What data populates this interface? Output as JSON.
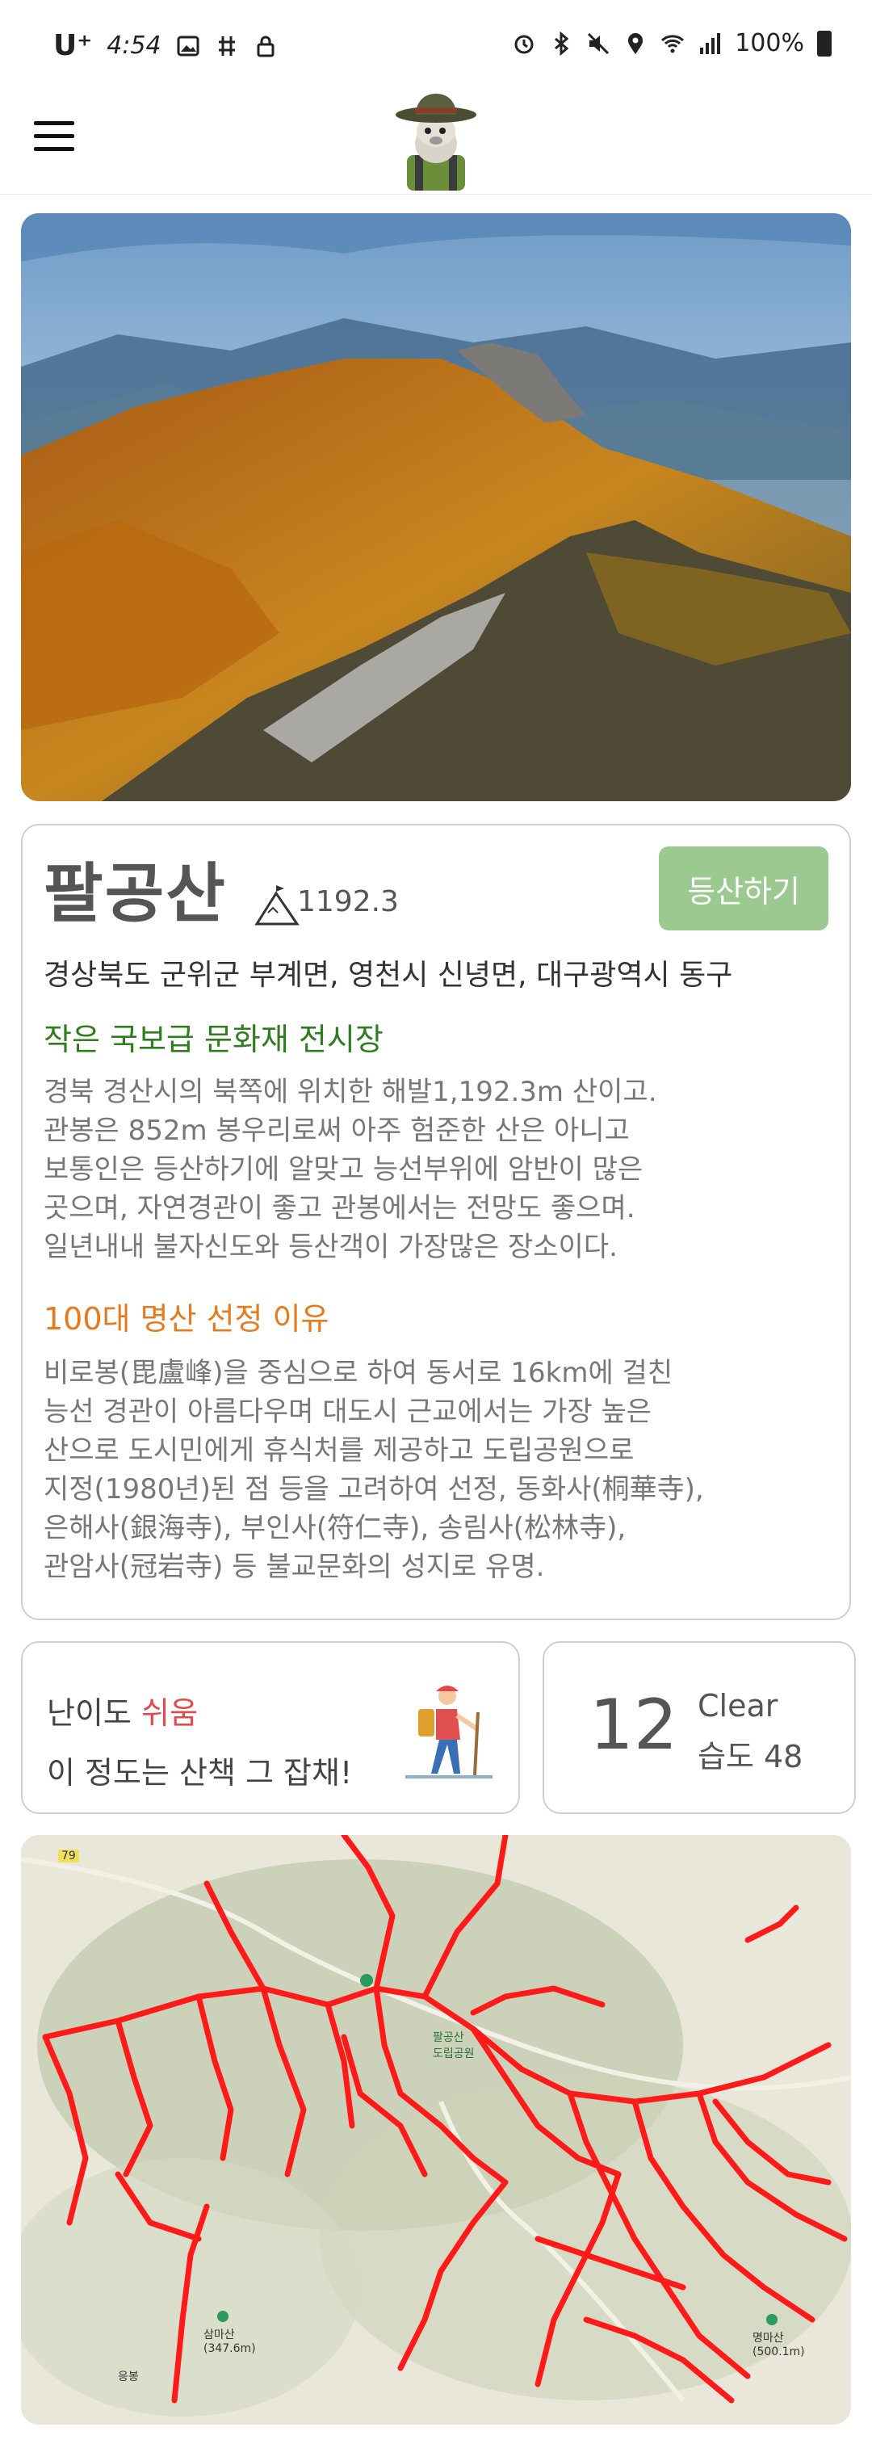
{
  "status_bar": {
    "carrier": "U⁺",
    "time": "4:54",
    "battery": "100%"
  },
  "header": {
    "menu_icon": "hamburger-menu-icon",
    "logo_icon": "mascot-hiker-logo"
  },
  "mountain": {
    "name": "팔공산",
    "height": "1192.3",
    "climb_button": "등산하기",
    "address": "경상북도 군위군 부계면, 영천시 신녕면, 대구광역시 동구",
    "section1_title": "작은 국보급 문화재 전시장",
    "section1_body": "경북 경산시의 북쪽에 위치한 해발1,192.3m 산이고.\n관봉은 852m 봉우리로써 아주 험준한 산은 아니고\n보통인은 등산하기에 알맞고 능선부위에 암반이 많은\n곳으며, 자연경관이 좋고 관봉에서는 전망도 좋으며.\n일년내내 불자신도와 등산객이 가장많은 장소이다.",
    "section2_title": "100대 명산 선정 이유",
    "section2_body": "비로봉(毘盧峰)을 중심으로 하여 동서로 16km에 걸친\n능선 경관이 아름다우며 대도시 근교에서는 가장 높은\n산으로 도시민에게 휴식처를 제공하고 도립공원으로\n지정(1980년)된 점 등을 고려하여 선정, 동화사(桐華寺),\n은해사(銀海寺), 부인사(符仁寺), 송림사(松林寺),\n관암사(冠岩寺) 등 불교문화의 성지로 유명."
  },
  "difficulty": {
    "label": "난이도",
    "value": "쉬움",
    "description": "이 정도는 산책 그 잡채!"
  },
  "weather": {
    "temperature": "12",
    "condition": "Clear",
    "humidity": "습도 48"
  },
  "map": {
    "labels": {
      "park": "팔공산\n도립공원",
      "peak1": "삼마산\n(347.6m)",
      "peak2": "명마산\n(500.1m)",
      "town": "응봉",
      "route": "79"
    }
  },
  "colors": {
    "climb_button": "#9bc98f",
    "difficulty_easy": "#e5484d",
    "section_green": "#2e7d1e",
    "section_orange": "#e87a1e",
    "trail": "#ff1a1a"
  }
}
